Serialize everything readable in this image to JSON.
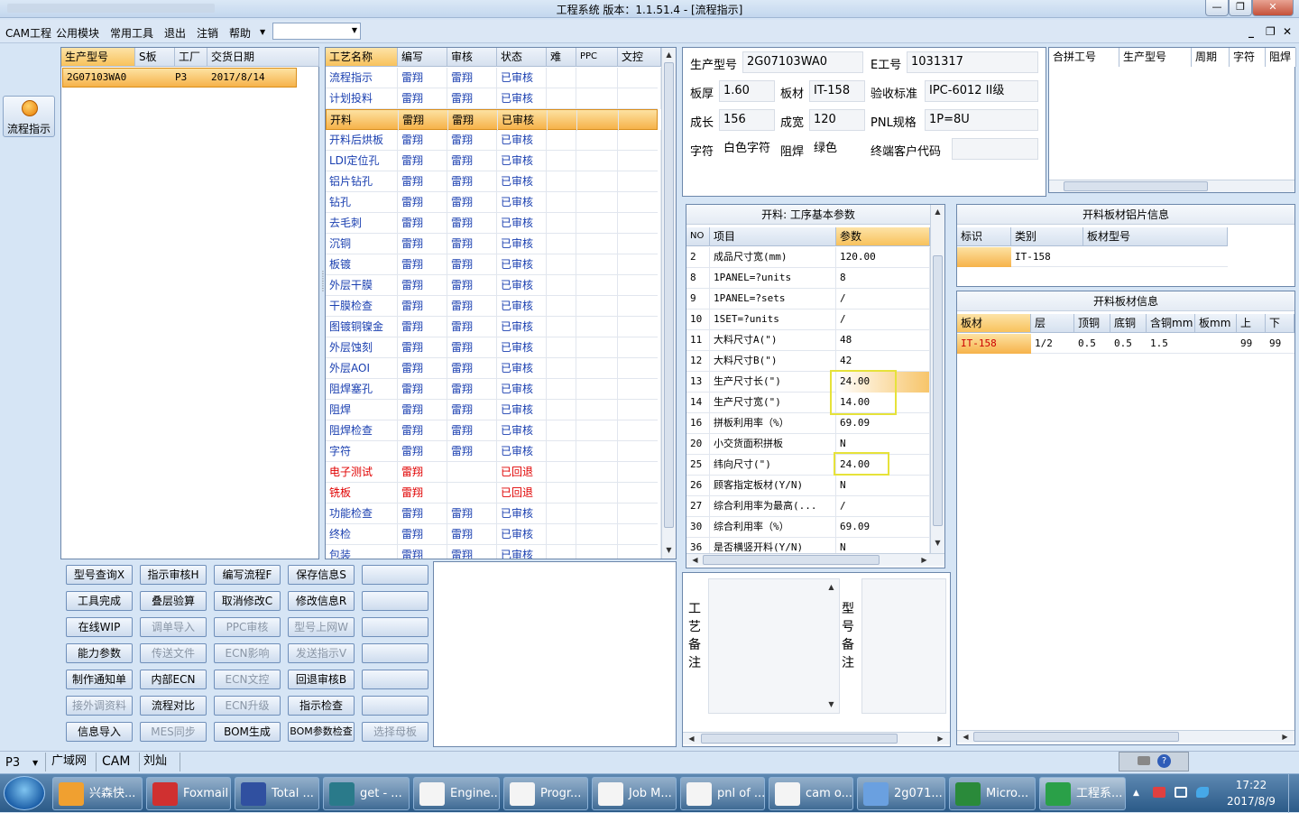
{
  "window": {
    "title": "工程系统   版本：1.1.51.4 - [流程指示]"
  },
  "menu": {
    "items": [
      "CAM工程",
      "公用模块",
      "常用工具",
      "退出",
      "注销",
      "帮助"
    ],
    "combo_value": ""
  },
  "left": {
    "flow_button": "流程指示"
  },
  "jobs": {
    "headers": [
      "生产型号",
      "S板",
      "工厂",
      "交货日期"
    ],
    "rows": [
      {
        "model": "2G07103WA0",
        "s": "",
        "factory": "P3",
        "date": "2017/8/14"
      }
    ]
  },
  "process": {
    "headers": [
      "工艺名称",
      "编写",
      "审核",
      "状态",
      "难",
      "PPC",
      "文控"
    ],
    "rows": [
      {
        "name": "流程指示",
        "writer": "雷翔",
        "reviewer": "雷翔",
        "status": "已审核"
      },
      {
        "name": "计划投料",
        "writer": "雷翔",
        "reviewer": "雷翔",
        "status": "已审核"
      },
      {
        "name": "开料",
        "writer": "雷翔",
        "reviewer": "雷翔",
        "status": "已审核"
      },
      {
        "name": "开料后烘板",
        "writer": "雷翔",
        "reviewer": "雷翔",
        "status": "已审核"
      },
      {
        "name": "LDI定位孔",
        "writer": "雷翔",
        "reviewer": "雷翔",
        "status": "已审核"
      },
      {
        "name": "铝片钻孔",
        "writer": "雷翔",
        "reviewer": "雷翔",
        "status": "已审核"
      },
      {
        "name": "钻孔",
        "writer": "雷翔",
        "reviewer": "雷翔",
        "status": "已审核"
      },
      {
        "name": "去毛刺",
        "writer": "雷翔",
        "reviewer": "雷翔",
        "status": "已审核"
      },
      {
        "name": "沉铜",
        "writer": "雷翔",
        "reviewer": "雷翔",
        "status": "已审核"
      },
      {
        "name": "板镀",
        "writer": "雷翔",
        "reviewer": "雷翔",
        "status": "已审核"
      },
      {
        "name": "外层干膜",
        "writer": "雷翔",
        "reviewer": "雷翔",
        "status": "已审核"
      },
      {
        "name": "干膜检查",
        "writer": "雷翔",
        "reviewer": "雷翔",
        "status": "已审核"
      },
      {
        "name": "图镀铜镍金",
        "writer": "雷翔",
        "reviewer": "雷翔",
        "status": "已审核"
      },
      {
        "name": "外层蚀刻",
        "writer": "雷翔",
        "reviewer": "雷翔",
        "status": "已审核"
      },
      {
        "name": "外层AOI",
        "writer": "雷翔",
        "reviewer": "雷翔",
        "status": "已审核"
      },
      {
        "name": "阻焊塞孔",
        "writer": "雷翔",
        "reviewer": "雷翔",
        "status": "已审核"
      },
      {
        "name": "阻焊",
        "writer": "雷翔",
        "reviewer": "雷翔",
        "status": "已审核"
      },
      {
        "name": "阻焊检查",
        "writer": "雷翔",
        "reviewer": "雷翔",
        "status": "已审核"
      },
      {
        "name": "字符",
        "writer": "雷翔",
        "reviewer": "雷翔",
        "status": "已审核"
      },
      {
        "name": "电子测试",
        "writer": "雷翔",
        "reviewer": "",
        "status": "已回退"
      },
      {
        "name": "铣板",
        "writer": "雷翔",
        "reviewer": "",
        "status": "已回退"
      },
      {
        "name": "功能检查",
        "writer": "雷翔",
        "reviewer": "雷翔",
        "status": "已审核"
      },
      {
        "name": "终检",
        "writer": "雷翔",
        "reviewer": "雷翔",
        "status": "已审核"
      },
      {
        "name": "包装",
        "writer": "雷翔",
        "reviewer": "雷翔",
        "status": "已审核"
      }
    ]
  },
  "actions": [
    [
      "型号查询X",
      "指示审核H",
      "编写流程F",
      "保存信息S",
      ""
    ],
    [
      "工具完成",
      "叠层验算",
      "取消修改C",
      "修改信息R",
      ""
    ],
    [
      "在线WIP",
      "调单导入",
      "PPC审核",
      "型号上网W",
      ""
    ],
    [
      "能力参数",
      "传送文件",
      "ECN影响",
      "发送指示V",
      ""
    ],
    [
      "制作通知单",
      "内部ECN",
      "ECN文控",
      "回退审核B",
      ""
    ],
    [
      "接外调资料",
      "流程对比",
      "ECN升级",
      "指示检查",
      ""
    ],
    [
      "信息导入",
      "MES同步",
      "BOM生成",
      "BOM参数检查",
      "选择母板"
    ]
  ],
  "info": {
    "model_label": "生产型号",
    "model_value": "2G07103WA0",
    "eno_label": "E工号",
    "eno_value": "1031317",
    "thickness_label": "板厚",
    "thickness_value": "1.60",
    "material_label": "板材",
    "material_value": "IT-158",
    "standard_label": "验收标准",
    "standard_value": "IPC-6012 II级",
    "length_label": "成长",
    "length_value": "156",
    "width_label": "成宽",
    "width_value": "120",
    "pnl_label": "PNL规格",
    "pnl_value": "1P=8U",
    "char_label": "字符",
    "char_value": "白色字符",
    "mask_label": "阻焊",
    "mask_value": "绿色",
    "customer_label": "终端客户代码",
    "customer_value": ""
  },
  "merge": {
    "headers": [
      "合拼工号",
      "生产型号",
      "周期",
      "字符",
      "阻焊"
    ]
  },
  "params": {
    "title": "开料: 工序基本参数",
    "headers": [
      "NO",
      "项目",
      "参数"
    ],
    "rows": [
      {
        "no": "2",
        "item": "成品尺寸宽(mm)",
        "value": "120.00"
      },
      {
        "no": "8",
        "item": "1PANEL=?units",
        "value": "8"
      },
      {
        "no": "9",
        "item": "1PANEL=?sets",
        "value": "/"
      },
      {
        "no": "10",
        "item": "1SET=?units",
        "value": "/"
      },
      {
        "no": "11",
        "item": "大料尺寸A(\")",
        "value": "48"
      },
      {
        "no": "12",
        "item": "大料尺寸B(\")",
        "value": "42"
      },
      {
        "no": "13",
        "item": "生产尺寸长(\")",
        "value": "24.00"
      },
      {
        "no": "14",
        "item": "生产尺寸宽(\")",
        "value": "14.00"
      },
      {
        "no": "16",
        "item": "拼板利用率（%）",
        "value": "69.09"
      },
      {
        "no": "20",
        "item": "小交货面积拼板",
        "value": "N"
      },
      {
        "no": "25",
        "item": "纬向尺寸(\")",
        "value": "24.00"
      },
      {
        "no": "26",
        "item": "顾客指定板材(Y/N)",
        "value": "N"
      },
      {
        "no": "27",
        "item": "综合利用率为最高(...",
        "value": "/"
      },
      {
        "no": "30",
        "item": "综合利用率（%）",
        "value": "69.09"
      },
      {
        "no": "36",
        "item": "是否横竖开料(Y/N)",
        "value": "N"
      }
    ]
  },
  "sheet_info": {
    "title": "开料板材铝片信息",
    "headers": [
      "标识",
      "类别",
      "板材型号"
    ],
    "rows": [
      {
        "mark": "",
        "category": "IT-158",
        "model": ""
      }
    ]
  },
  "board_info": {
    "title": "开料板材信息",
    "headers": [
      "板材",
      "层",
      "顶铜",
      "底铜",
      "含铜mm",
      "板mm",
      "上",
      "下"
    ],
    "rows": [
      {
        "material": "IT-158",
        "layer": "1/2",
        "top": "0.5",
        "bottom": "0.5",
        "copper": "1.5",
        "board": "",
        "up": "99",
        "down": "99"
      }
    ]
  },
  "notes": {
    "process_label": [
      "工",
      "艺",
      "备",
      "注"
    ],
    "model_label": [
      "型",
      "号",
      "备",
      "注"
    ]
  },
  "status": {
    "factory": "P3",
    "items": [
      "广域网",
      "CAM",
      "刘灿"
    ]
  },
  "taskbar": {
    "items": [
      "兴森快...",
      "Foxmail",
      "Total ...",
      "get - ...",
      "Engine...",
      "Progr...",
      "Job M...",
      "pnl of ...",
      "cam o...",
      "2g071...",
      "Micro...",
      "工程系..."
    ],
    "time": "17:22",
    "date": "2017/8/9"
  },
  "colors": {
    "accent": "#f6b24a",
    "highlight": "#e6e23a",
    "blue_text": "#1a3fb0",
    "red_text": "#e00000"
  }
}
